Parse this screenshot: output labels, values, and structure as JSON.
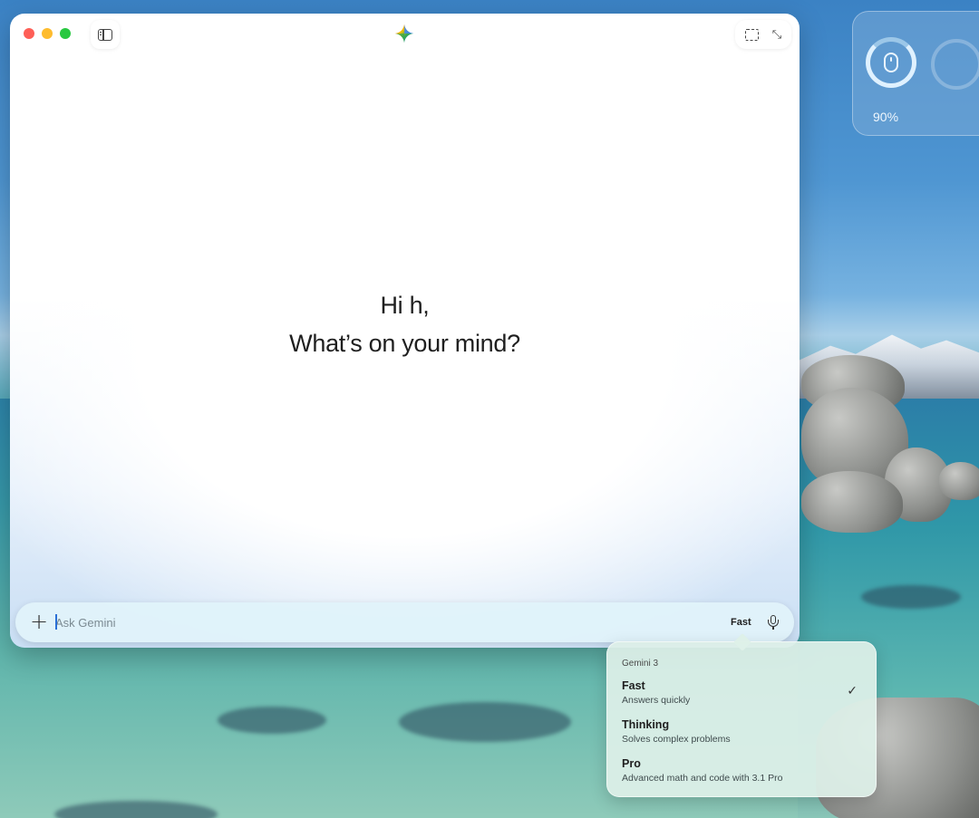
{
  "window": {
    "greeting_line1": "Hi h,",
    "greeting_line2": "What’s on your mind?"
  },
  "icons": {
    "sidebar": "sidebar-toggle-icon",
    "logo": "gemini-sparkle-icon",
    "screenshot": "screenshot-select-icon",
    "collapse": "collapse-icon",
    "add": "plus-icon",
    "mic": "microphone-icon",
    "check": "checkmark-icon"
  },
  "input": {
    "placeholder": "Ask Gemini",
    "value": "",
    "mode_label": "Fast"
  },
  "widget": {
    "battery_label": "90%",
    "battery_level": 0.9
  },
  "model_menu": {
    "heading": "Gemini 3",
    "items": [
      {
        "title": "Fast",
        "subtitle": "Answers quickly",
        "selected": true
      },
      {
        "title": "Thinking",
        "subtitle": "Solves complex problems",
        "selected": false
      },
      {
        "title": "Pro",
        "subtitle": "Advanced math and code with 3.1 Pro",
        "selected": false
      }
    ]
  },
  "colors": {
    "traffic_red": "#fe5f57",
    "traffic_yellow": "#febc2e",
    "traffic_green": "#28c840",
    "caret": "#2a6fd6"
  }
}
